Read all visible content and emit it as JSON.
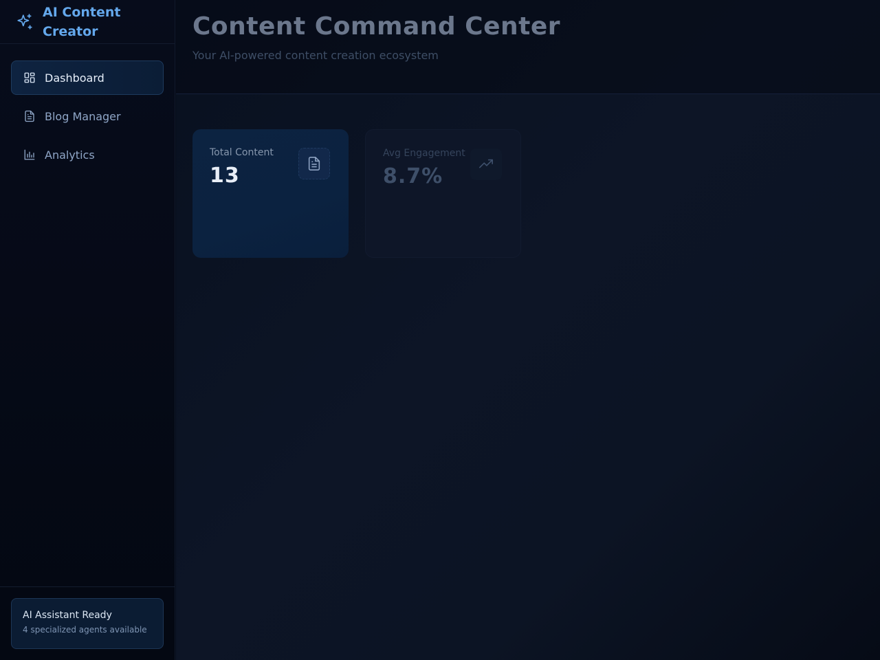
{
  "brand": {
    "title": "AI Content Creator",
    "icon": "sparkles-icon",
    "color": "#64a8ec"
  },
  "sidebar": {
    "items": [
      {
        "label": "Dashboard",
        "icon": "dashboard-icon",
        "active": true
      },
      {
        "label": "Blog Manager",
        "icon": "document-icon",
        "active": false
      },
      {
        "label": "Analytics",
        "icon": "bar-chart-icon",
        "active": false
      }
    ],
    "assistant": {
      "title": "AI Assistant Ready",
      "subtitle": "4 specialized agents available"
    }
  },
  "header": {
    "title": "Content Command Center",
    "subtitle": "Your AI-powered content creation ecosystem"
  },
  "stats": [
    {
      "label": "Total Content",
      "value": "13",
      "icon": "document-icon"
    },
    {
      "label": "Avg Engagement",
      "value": "8.7%",
      "icon": "trending-up-icon"
    }
  ]
}
